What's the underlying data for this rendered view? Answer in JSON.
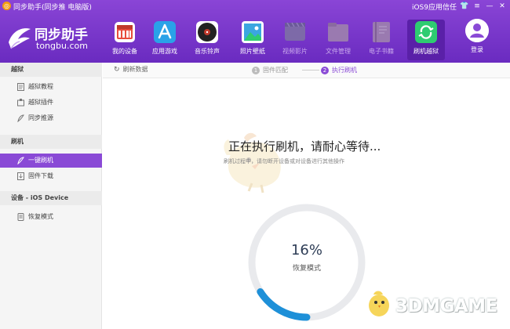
{
  "window": {
    "title": "同步助手(同步推 电脑版)",
    "ios9_trust_label": "iOS9应用信任"
  },
  "brand": {
    "name": "同步助手",
    "url": "tongbu.com"
  },
  "nav": [
    {
      "label": "我的设备",
      "icon": "device-icon",
      "color": "#e74c3c",
      "state": "normal"
    },
    {
      "label": "应用游戏",
      "icon": "app-store-icon",
      "color": "#2aa2e8",
      "state": "normal"
    },
    {
      "label": "音乐铃声",
      "icon": "music-disc-icon",
      "color": "#222222",
      "state": "normal"
    },
    {
      "label": "照片壁纸",
      "icon": "photo-icon",
      "color": "#3ba6e0",
      "state": "normal"
    },
    {
      "label": "视频影片",
      "icon": "video-icon",
      "color": "#7d6aa8",
      "state": "disabled"
    },
    {
      "label": "文件管理",
      "icon": "folder-icon",
      "color": "#9a7ab0",
      "state": "disabled"
    },
    {
      "label": "电子书籍",
      "icon": "book-icon",
      "color": "#9a7ab0",
      "state": "disabled"
    },
    {
      "label": "刷机越狱",
      "icon": "flash-jailbreak-icon",
      "color": "#2ecc71",
      "state": "active"
    }
  ],
  "login": {
    "label": "登录"
  },
  "sidebar": {
    "sections": [
      {
        "title": "越狱",
        "items": [
          {
            "label": "越狱教程",
            "icon": "book-icon"
          },
          {
            "label": "越狱插件",
            "icon": "plugin-icon"
          },
          {
            "label": "同步推源",
            "icon": "source-icon"
          }
        ]
      },
      {
        "title": "刷机",
        "items": [
          {
            "label": "一键刷机",
            "icon": "flash-icon",
            "active": true
          },
          {
            "label": "固件下载",
            "icon": "download-icon"
          }
        ]
      },
      {
        "title": "设备 - iOS Device",
        "items": [
          {
            "label": "恢复模式",
            "icon": "recovery-icon"
          }
        ]
      }
    ]
  },
  "toolbar": {
    "refresh_label": "刷新数据",
    "steps": [
      {
        "num": "1",
        "label": "固件匹配",
        "active": false
      },
      {
        "num": "2",
        "label": "执行刷机",
        "active": true
      }
    ]
  },
  "main": {
    "title": "正在执行刷机，请耐心等待...",
    "note": "刷机过程中，请勿断开设备或对设备进行其他操作",
    "progress": {
      "percent": 16,
      "value_text": "16%",
      "label": "恢复模式"
    },
    "accent_color": "#1e90d8"
  },
  "watermark": {
    "text": "3DMGAME"
  }
}
